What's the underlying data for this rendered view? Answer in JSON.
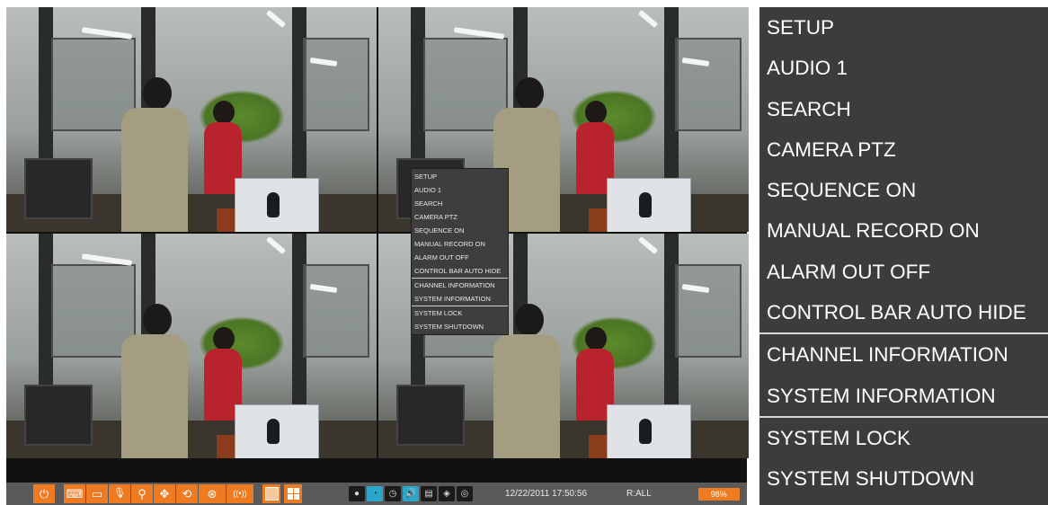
{
  "menu": {
    "group1": [
      "SETUP",
      "AUDIO 1",
      "SEARCH",
      "CAMERA PTZ",
      "SEQUENCE ON",
      "MANUAL RECORD ON",
      "ALARM OUT OFF",
      "CONTROL BAR AUTO HIDE"
    ],
    "group2": [
      "CHANNEL INFORMATION",
      "SYSTEM INFORMATION"
    ],
    "group3": [
      "SYSTEM LOCK",
      "SYSTEM SHUTDOWN"
    ]
  },
  "control_bar": {
    "datetime": "12/22/2011 17:50:56",
    "record_status": "R:ALL",
    "disk_usage": "98%",
    "buttons": {
      "power": "⏻",
      "keyboard": "⌨",
      "monitor": "▭",
      "audio": "🎙",
      "zoom": "⚲",
      "ptz": "✥",
      "sequence": "⟲",
      "pan": "⊛",
      "alarm": "((•))"
    },
    "status_icons": [
      "●",
      "◔",
      "◷",
      "🔊",
      "▤",
      "◈",
      "◎"
    ],
    "accent_color": "#ee7a22"
  }
}
